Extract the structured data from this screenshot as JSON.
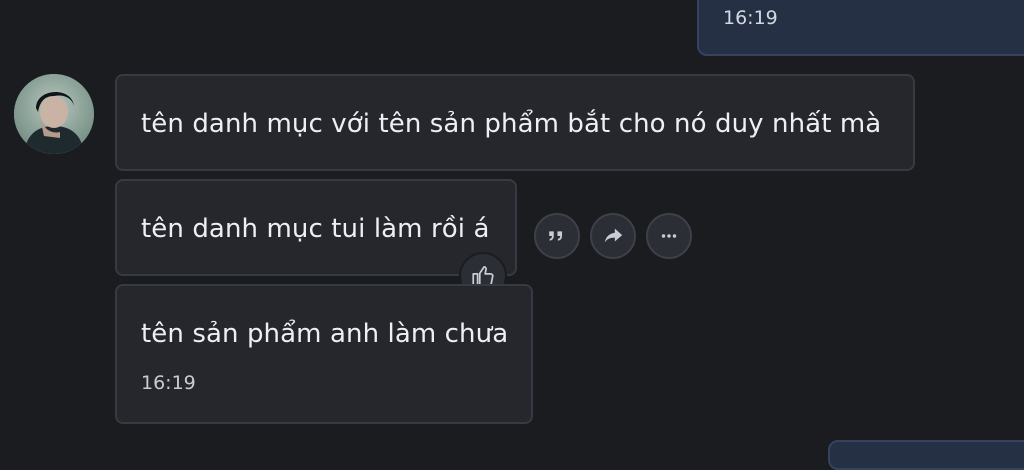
{
  "chat": {
    "sent_message": {
      "time": "16:19"
    },
    "received_messages": [
      {
        "text": "tên danh mục với tên sản phẩm bắt cho nó duy nhất mà"
      },
      {
        "text": "tên danh mục tui làm rồi á",
        "reaction": "thumbs-up-icon"
      },
      {
        "text": "tên sản phẩm anh làm chưa",
        "time": "16:19"
      }
    ],
    "message_actions": [
      {
        "icon": "quote-icon"
      },
      {
        "icon": "forward-icon"
      },
      {
        "icon": "more-icon"
      }
    ]
  },
  "colors": {
    "background": "#1b1c20",
    "received_bubble": "#25272c",
    "sent_bubble": "#253044",
    "text": "#eceff3"
  }
}
